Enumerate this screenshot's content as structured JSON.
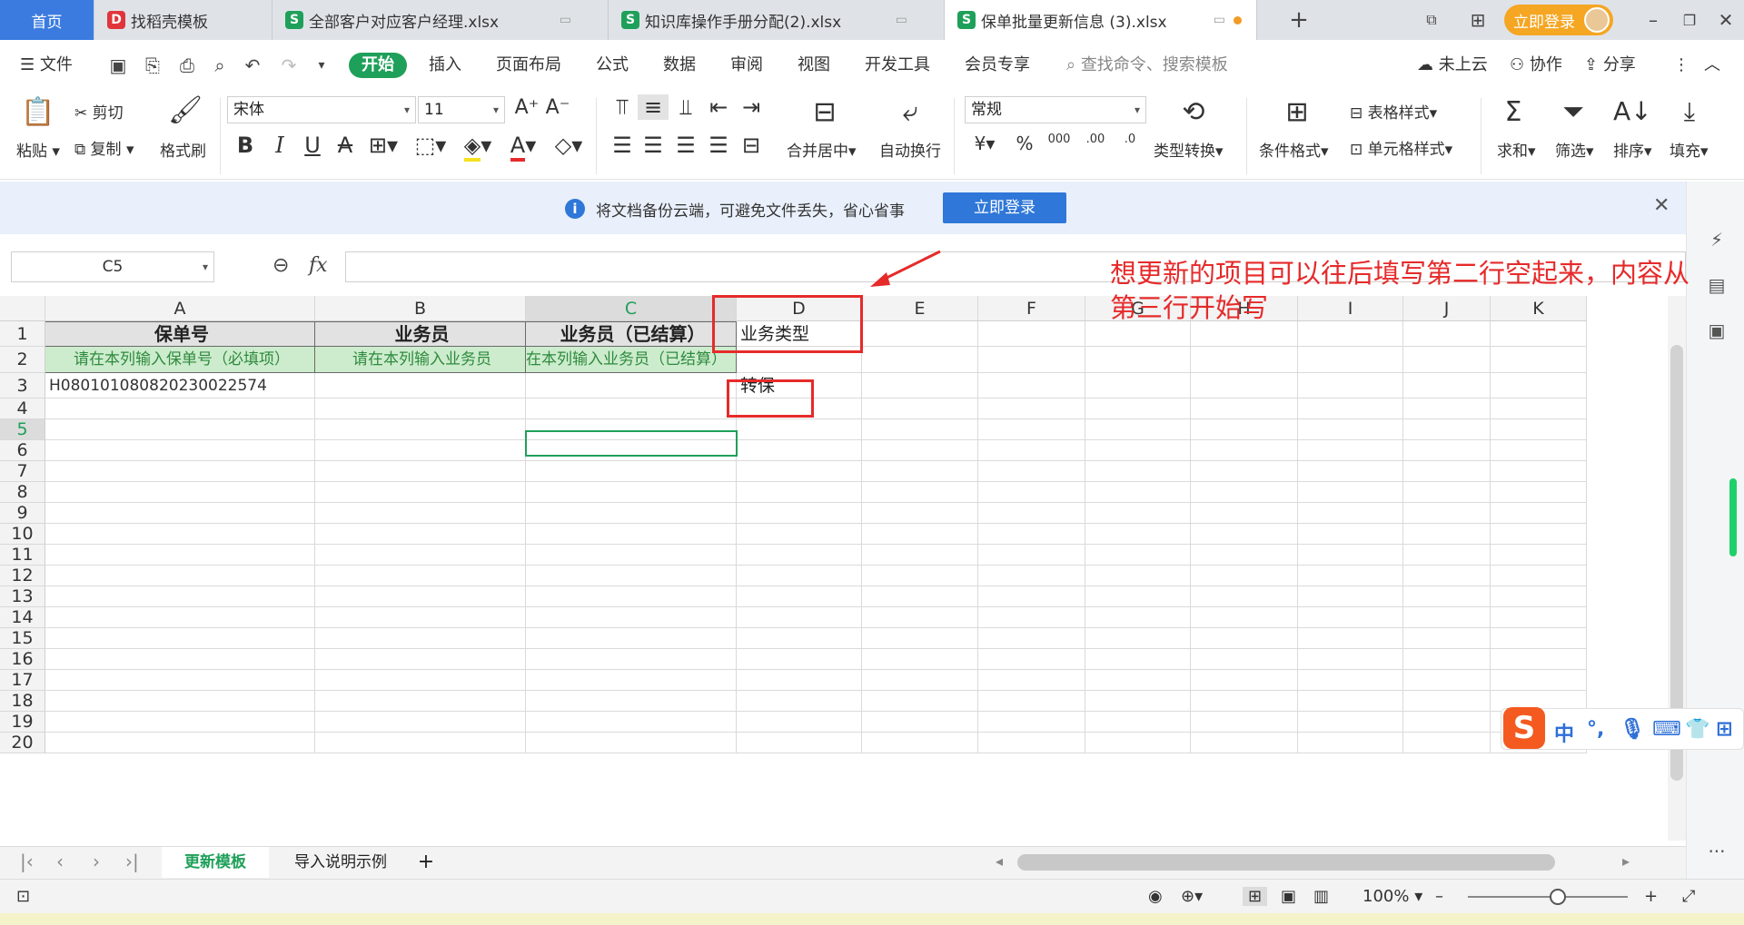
{
  "tabs": {
    "home": "首页",
    "template": "找稻壳模板",
    "file1": "全部客户对应客户经理.xlsx",
    "file2": "知识库操作手册分配(2).xlsx",
    "file3": "保单批量更新信息 (3).xlsx",
    "login": "立即登录"
  },
  "menu": {
    "file": "文件",
    "items": [
      "开始",
      "插入",
      "页面布局",
      "公式",
      "数据",
      "审阅",
      "视图",
      "开发工具",
      "会员专享"
    ],
    "search": "查找命令、搜索模板",
    "cloud": "未上云",
    "collab": "协作",
    "share": "分享"
  },
  "ribbon": {
    "paste": "粘贴",
    "cut": "剪切",
    "copy": "复制",
    "format_painter": "格式刷",
    "font_name": "宋体",
    "font_size": "11",
    "merge": "合并居中",
    "wrap": "自动换行",
    "number_format": "常规",
    "type_convert": "类型转换",
    "cond_format": "条件格式",
    "table_style": "表格样式",
    "cell_style": "单元格样式",
    "sum": "求和",
    "filter": "筛选",
    "sort": "排序",
    "fill": "填充"
  },
  "notice": {
    "text": "将文档备份云端，可避免文件丢失，省心省事",
    "button": "立即登录"
  },
  "formula_bar": {
    "name_box": "C5",
    "fx": "fx",
    "value": ""
  },
  "grid": {
    "columns": [
      "A",
      "B",
      "C",
      "D",
      "E",
      "F",
      "G",
      "H",
      "I",
      "J",
      "K"
    ],
    "selected_column": "C",
    "selected_row": "5",
    "rows": [
      "1",
      "2",
      "3",
      "4",
      "5",
      "6",
      "7",
      "8",
      "9",
      "10",
      "11",
      "12",
      "13",
      "14",
      "15",
      "16",
      "17",
      "18",
      "19",
      "20"
    ],
    "row1": {
      "A": "保单号",
      "B": "业务员",
      "C": "业务员（已结算）",
      "D": "业务类型"
    },
    "row2": {
      "A": "请在本列输入保单号（必填项）",
      "B": "请在本列输入业务员",
      "C": "在本列输入业务员（已结算）"
    },
    "row3": {
      "A": "H080101080820230022574",
      "D": "转保"
    }
  },
  "annotation": "想更新的项目可以往后填写第二行空起来，内容从第三行开始写",
  "sheets": {
    "active": "更新模板",
    "other": "导入说明示例",
    "add": "+"
  },
  "status": {
    "zoom": "100%"
  },
  "ime": {
    "logo": "S",
    "mode": "中",
    "punct": "°,"
  },
  "colors": {
    "accent": "#1fa05a",
    "annotation": "#e62a2a",
    "home_tab": "#3b7be0",
    "notice_btn": "#2f77d8",
    "login_pill": "#f5a623"
  }
}
